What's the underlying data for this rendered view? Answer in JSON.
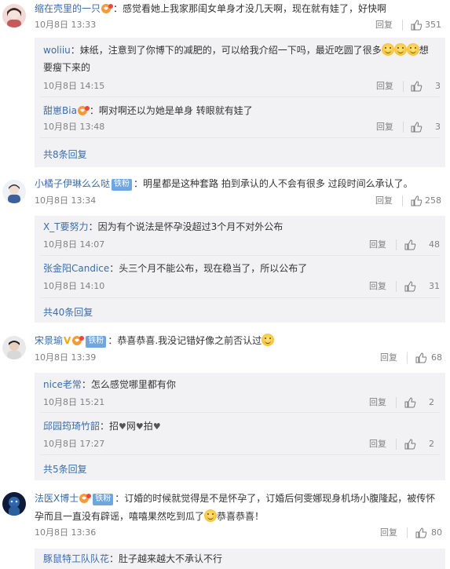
{
  "labels": {
    "reply": "回复",
    "fan_badge": "铁粉"
  },
  "comments": [
    {
      "user": "缩在壳里的一只",
      "text": "：感觉看她上我家那闺女单身才没几天啊，现在就有娃了，好快啊",
      "time": "10月8日 13:33",
      "likes": "351",
      "replies": [
        {
          "user": "woliiu",
          "text1": "：妹纸，注意到了你博下的减肥的，可以给我介绍一下吗，最近吃圆了很多",
          "text2": "要瘦下来的",
          "text_tail": "想",
          "time": "10月8日 14:15",
          "likes": "3"
        },
        {
          "user": "甜崽Bia",
          "text1": "：啊对啊还以为她是单身 转眼就有娃了",
          "time": "10月8日 13:48",
          "likes": "3"
        }
      ],
      "more": "共8条回复"
    },
    {
      "user": "小橘子伊琳么么哒",
      "text": "：明星都是这种套路 拍到承认的人不会有很多 过段时间么承认了。",
      "time": "10月8日 13:34",
      "likes": "258",
      "replies": [
        {
          "user": "X_T要努力",
          "text1": "：因为有个说法是怀孕没超过3个月不对外公布",
          "time": "10月8日 14:07",
          "likes": "48"
        },
        {
          "user": "张金阳Candice",
          "text1": "：头三个月不能公布，现在稳当了，所以公布了",
          "time": "10月8日 14:10",
          "likes": "31"
        }
      ],
      "more": "共40条回复"
    },
    {
      "user": "宋景瑜",
      "text": "：恭喜恭喜.我没记错好像之前否认过",
      "time": "10月8日 13:39",
      "likes": "68",
      "replies": [
        {
          "user": "nice老常",
          "text1": "：怎么感觉哪里都有你",
          "time": "10月8日 15:21",
          "likes": "2"
        },
        {
          "user": "邱园筠琦竹韶",
          "text1": "：招",
          "text_mid1": "网",
          "text_mid2": "拍",
          "time": "10月8日 17:27",
          "likes": "2"
        }
      ],
      "more": "共5条回复"
    },
    {
      "user": "法医X博士",
      "text": "：订婚的时候就觉得是不是怀孕了，订婚后何雯娜现身机场小腹隆起，被传怀",
      "text2": "孕而且一直没有辟谣，嘻嘻果然吃到瓜了",
      "text2_tail": "恭喜恭喜！",
      "time": "10月8日 13:36",
      "likes": "80",
      "replies": [
        {
          "user": "豚鼠特工队队花",
          "text1": "：肚子越来越大不承认不行"
        }
      ]
    }
  ]
}
